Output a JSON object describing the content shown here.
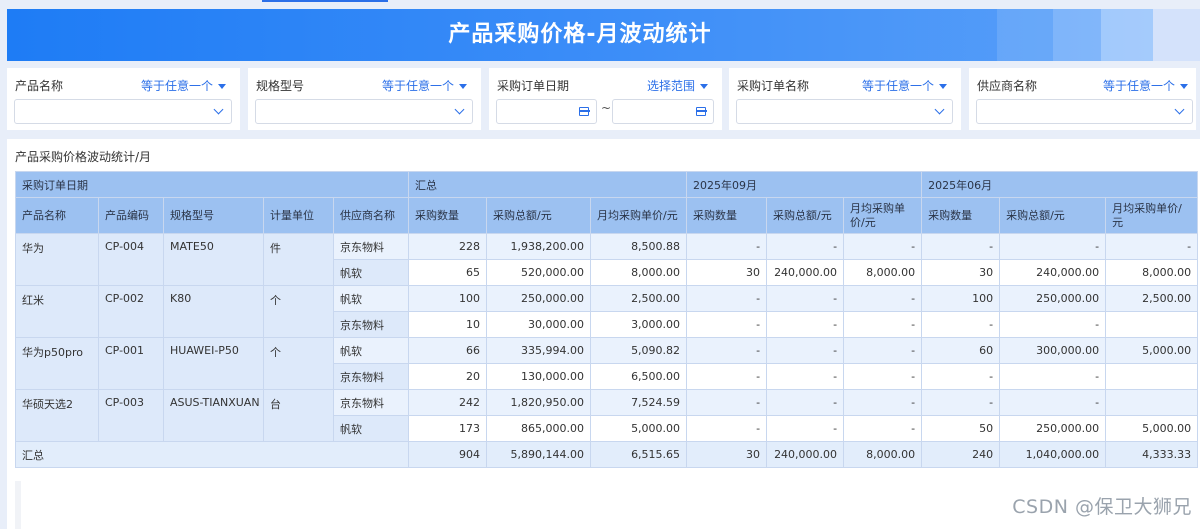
{
  "page_title": "产品采购价格-月波动统计",
  "filters": [
    {
      "label": "产品名称",
      "operator": "等于任意一个"
    },
    {
      "label": "规格型号",
      "operator": "等于任意一个"
    },
    {
      "label": "采购订单日期",
      "operator": "选择范围",
      "separator": "~"
    },
    {
      "label": "采购订单名称",
      "operator": "等于任意一个"
    },
    {
      "label": "供应商名称",
      "operator": "等于任意一个"
    }
  ],
  "report": {
    "title": "产品采购价格波动统计/月",
    "header_row1": {
      "date_group": "采购订单日期",
      "summary": "汇总",
      "month1": "2025年09月",
      "month2": "2025年06月"
    },
    "columns": [
      "产品名称",
      "产品编码",
      "规格型号",
      "计量单位",
      "供应商名称",
      "采购数量",
      "采购总额/元",
      "月均采购单价/元",
      "采购数量",
      "采购总额/元",
      "月均采购单价/元",
      "采购数量",
      "采购总额/元",
      "月均采购单价/元"
    ],
    "groups": [
      {
        "product": "华为",
        "code": "CP-004",
        "spec": "MATE50",
        "unit": "件",
        "rows": [
          [
            "京东物料",
            "228",
            "1,938,200.00",
            "8,500.88",
            "-",
            "-",
            "-",
            "-",
            "-",
            "-"
          ],
          [
            "帆软",
            "65",
            "520,000.00",
            "8,000.00",
            "30",
            "240,000.00",
            "8,000.00",
            "30",
            "240,000.00",
            "8,000.00"
          ]
        ]
      },
      {
        "product": "红米",
        "code": "CP-002",
        "spec": "K80",
        "unit": "个",
        "rows": [
          [
            "帆软",
            "100",
            "250,000.00",
            "2,500.00",
            "-",
            "-",
            "-",
            "100",
            "250,000.00",
            "2,500.00"
          ],
          [
            "京东物料",
            "10",
            "30,000.00",
            "3,000.00",
            "-",
            "-",
            "-",
            "-",
            "-",
            ""
          ]
        ]
      },
      {
        "product": "华为p50pro",
        "code": "CP-001",
        "spec": "HUAWEI-P50",
        "unit": "个",
        "rows": [
          [
            "帆软",
            "66",
            "335,994.00",
            "5,090.82",
            "-",
            "-",
            "-",
            "60",
            "300,000.00",
            "5,000.00"
          ],
          [
            "京东物料",
            "20",
            "130,000.00",
            "6,500.00",
            "-",
            "-",
            "-",
            "-",
            "-",
            ""
          ]
        ]
      },
      {
        "product": "华硕天选2",
        "code": "CP-003",
        "spec": "ASUS-TIANXUAN",
        "unit": "台",
        "rows": [
          [
            "京东物料",
            "242",
            "1,820,950.00",
            "7,524.59",
            "-",
            "-",
            "-",
            "-",
            "-",
            ""
          ],
          [
            "帆软",
            "173",
            "865,000.00",
            "5,000.00",
            "-",
            "-",
            "-",
            "50",
            "250,000.00",
            "5,000.00"
          ]
        ]
      }
    ],
    "total": {
      "label": "汇总",
      "values": [
        "904",
        "5,890,144.00",
        "6,515.65",
        "30",
        "240,000.00",
        "8,000.00",
        "240",
        "1,040,000.00",
        "4,333.33"
      ]
    }
  },
  "watermark": "CSDN @保卫大狮兄"
}
